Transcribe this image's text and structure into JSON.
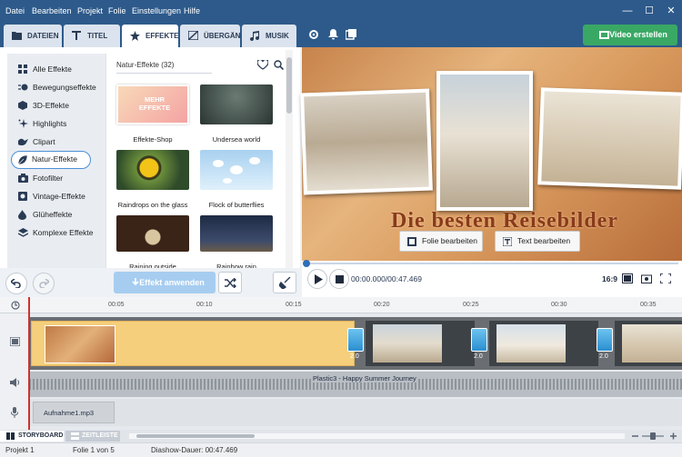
{
  "menu": [
    "Datei",
    "Bearbeiten",
    "Projekt",
    "Folie",
    "Einstellungen",
    "Hilfe"
  ],
  "tabs": [
    {
      "label": "DATEIEN",
      "icon": "folder-icon"
    },
    {
      "label": "TITEL",
      "icon": "text-t-icon"
    },
    {
      "label": "EFFEKTE",
      "icon": "magic-star-icon",
      "active": true
    },
    {
      "label": "ÜBERGÄNGE",
      "icon": "transition-icon"
    },
    {
      "label": "MUSIK",
      "icon": "music-note-icon"
    }
  ],
  "create_button": "Video erstellen",
  "sidebar": [
    {
      "label": "Alle Effekte",
      "icon": "grid-icon"
    },
    {
      "label": "Bewegungseffekte",
      "icon": "motion-icon"
    },
    {
      "label": "3D-Effekte",
      "icon": "cube-icon"
    },
    {
      "label": "Highlights",
      "icon": "sparkle-icon"
    },
    {
      "label": "Clipart",
      "icon": "bird-icon"
    },
    {
      "label": "Natur-Effekte",
      "icon": "leaf-icon",
      "active": true
    },
    {
      "label": "Fotofilter",
      "icon": "camera-icon"
    },
    {
      "label": "Vintage-Effekte",
      "icon": "vintage-icon"
    },
    {
      "label": "Glüheffekte",
      "icon": "drop-icon"
    },
    {
      "label": "Komplexe Effekte",
      "icon": "layers-icon"
    }
  ],
  "effects_title": "Natur-Effekte (32)",
  "effects": [
    {
      "label": "Effekte-Shop",
      "thumb_text": "MEHR EFFEKTE"
    },
    {
      "label": "Undersea world"
    },
    {
      "label": "Raindrops on the glass"
    },
    {
      "label": "Flock of butterflies"
    },
    {
      "label": "Raining outside"
    },
    {
      "label": "Rainbow rain"
    }
  ],
  "apply_button": "Effekt anwenden",
  "preview": {
    "title": "Die besten Reisebilder",
    "edit_slide": "Folie bearbeiten",
    "edit_text": "Text bearbeiten",
    "time": "00:00.000/00:47.469",
    "aspect": "16:9"
  },
  "ruler": [
    "00:05",
    "00:10",
    "00:15",
    "00:20",
    "00:25",
    "00:30",
    "00:35"
  ],
  "timeline": {
    "transitions": [
      "2.0",
      "2.0",
      "2.0"
    ],
    "audio_label": "Plastic3 - Happy Summer Journey",
    "voice_label": "Aufnahme1.mp3"
  },
  "view_tabs": {
    "storyboard": "STORYBOARD",
    "timeline": "ZEITLEISTE"
  },
  "status": {
    "project": "Projekt 1",
    "slide": "Folie 1 von 5",
    "duration": "Diashow-Dauer: 00:47.469"
  }
}
